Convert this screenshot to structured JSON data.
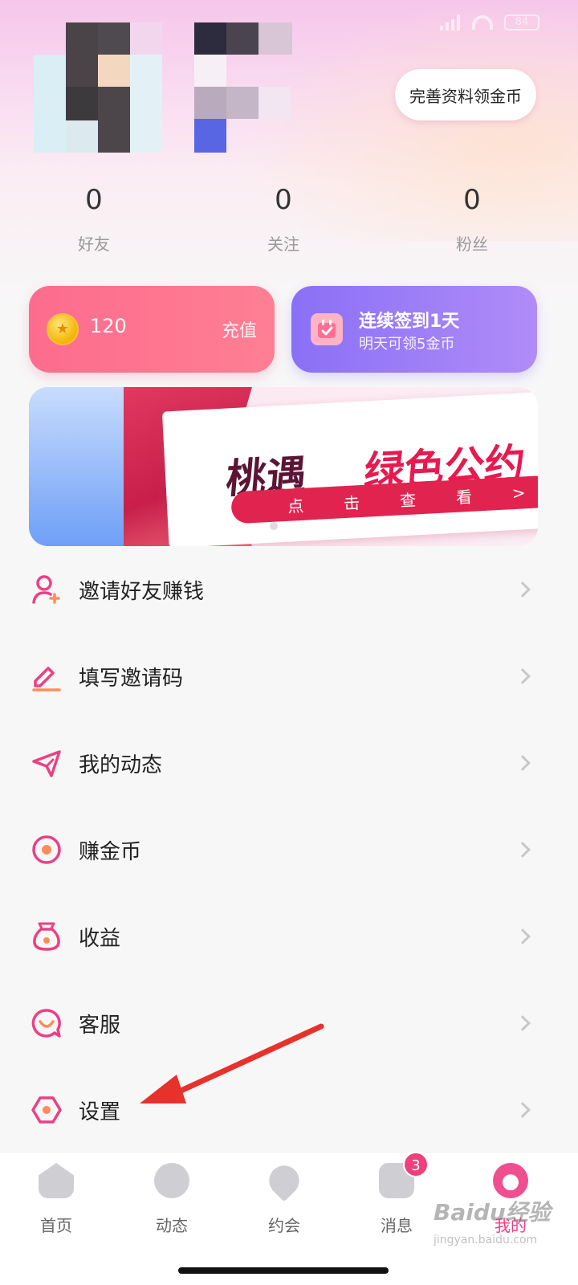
{
  "profile": {
    "complete_button": "完善资料领金币"
  },
  "stats": [
    {
      "value": "0",
      "label": "好友"
    },
    {
      "value": "0",
      "label": "关注"
    },
    {
      "value": "0",
      "label": "粉丝"
    }
  ],
  "coins": {
    "amount": "120",
    "recharge_label": "充值"
  },
  "sign_in": {
    "title": "连续签到1天",
    "subtitle": "明天可领5金币"
  },
  "banner": {
    "title_part1": "桃遇",
    "title_part2": "绿色公约",
    "cta": "点击查看",
    "cta_arrow": ">"
  },
  "menu": [
    {
      "label": "邀请好友赚钱",
      "icon": "invite-user-icon"
    },
    {
      "label": "填写邀请码",
      "icon": "pen-icon"
    },
    {
      "label": "我的动态",
      "icon": "send-icon"
    },
    {
      "label": "赚金币",
      "icon": "coin-target-icon"
    },
    {
      "label": "收益",
      "icon": "money-bag-icon"
    },
    {
      "label": "客服",
      "icon": "customer-service-icon"
    },
    {
      "label": "设置",
      "icon": "settings-hex-icon"
    }
  ],
  "tabbar": {
    "items": [
      {
        "label": "首页",
        "icon": "home-icon"
      },
      {
        "label": "动态",
        "icon": "compass-icon"
      },
      {
        "label": "约会",
        "icon": "heart-icon"
      },
      {
        "label": "消息",
        "icon": "message-icon",
        "badge": "3"
      },
      {
        "label": "我的",
        "icon": "profile-icon",
        "active": true
      }
    ]
  },
  "watermark": {
    "brand": "Baidu经验",
    "url": "jingyan.baidu.com"
  },
  "colors": {
    "accent_pink": "#ee3f83",
    "coin_card": "#fd6c8e",
    "sign_card": "#8a70f6"
  }
}
